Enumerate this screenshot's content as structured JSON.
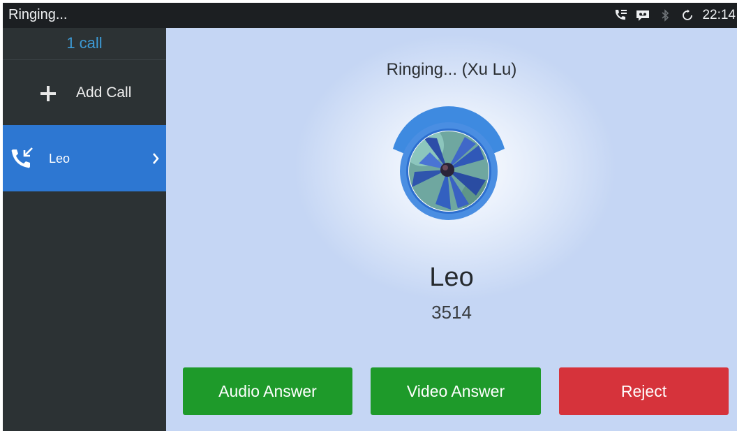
{
  "statusbar": {
    "title": "Ringing...",
    "time": "22:14",
    "icons": [
      "call-icon",
      "voicemail-icon",
      "bluetooth-icon",
      "sync-icon"
    ]
  },
  "sidebar": {
    "call_count": "1 call",
    "add_call_label": "Add Call",
    "calls": [
      {
        "name": "Leo",
        "icon": "incoming-call-icon",
        "selected": true
      }
    ]
  },
  "main": {
    "ringing_text": "Ringing... (Xu Lu)",
    "caller_name": "Leo",
    "caller_number": "3514",
    "buttons": {
      "audio_answer": "Audio Answer",
      "video_answer": "Video Answer",
      "reject": "Reject"
    }
  },
  "colors": {
    "accent_blue": "#2d77d2",
    "answer_green": "#1e9a2a",
    "reject_red": "#d6333b",
    "call_count_text": "#3d9bd6"
  }
}
